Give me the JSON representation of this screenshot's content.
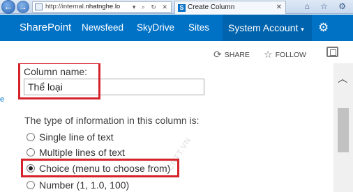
{
  "browser": {
    "address_prefix": "http://internal.",
    "address_domain": "nhatnghe.lo",
    "address_tools": "▾ ⌕ ↻ ✕",
    "tab_title": "Create Column",
    "tab_icon_letter": "S",
    "tab_close": "✕",
    "right_icons": "⌂ ☆ ⚙"
  },
  "suitebar": {
    "brand": "SharePoint",
    "nav": {
      "newsfeed": "Newsfeed",
      "skydrive": "SkyDrive",
      "sites": "Sites"
    },
    "account": "System Account",
    "account_caret": "▾",
    "settings_icon": "⚙"
  },
  "ribbon": {
    "share": "SHARE",
    "follow": "FOLLOW"
  },
  "form": {
    "left_fragment": "e",
    "column_name_label": "Column name:",
    "column_name_value": "Thể loại",
    "type_question": "The type of information in this column is:",
    "options": [
      {
        "label": "Single line of text",
        "selected": false
      },
      {
        "label": "Multiple lines of text",
        "selected": false
      },
      {
        "label": "Choice (menu to choose from)",
        "selected": true
      },
      {
        "label": "Number (1, 1.0, 100)",
        "selected": false
      }
    ]
  },
  "watermark": "CNTT.VN",
  "colors": {
    "suitebar": "#0072c6",
    "highlight": "#d4232b"
  }
}
